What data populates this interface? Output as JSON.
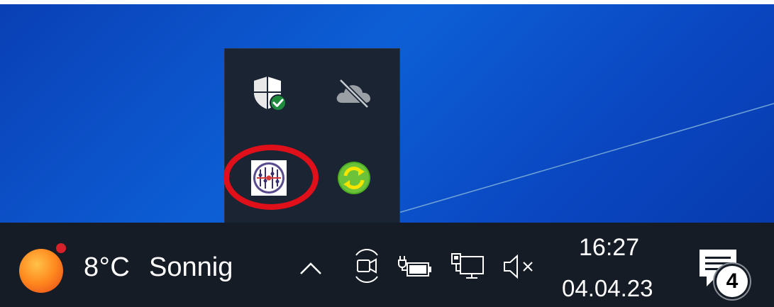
{
  "taskbar": {
    "weather": {
      "temperature": "8°C",
      "condition": "Sonnig"
    },
    "clock": {
      "time": "16:27",
      "date": "04.04.23"
    },
    "notifications": {
      "count": "4"
    },
    "icons": [
      "chevron-up-icon",
      "meet-now-icon",
      "power-plug-battery-icon",
      "network-ethernet-icon",
      "volume-muted-icon",
      "action-center-icon"
    ]
  },
  "tray_flyout": {
    "icons": [
      "windows-security-shield-icon",
      "onedrive-disconnected-icon",
      "app-sliders-icon",
      "green-sync-icon"
    ]
  },
  "colors": {
    "desktop": "#0d5fd6",
    "taskbar": "#161c25",
    "flyout": "#1b2433",
    "highlight": "#e0101a",
    "security_check": "#1e8a3c",
    "sync_green": "#4caf22"
  }
}
